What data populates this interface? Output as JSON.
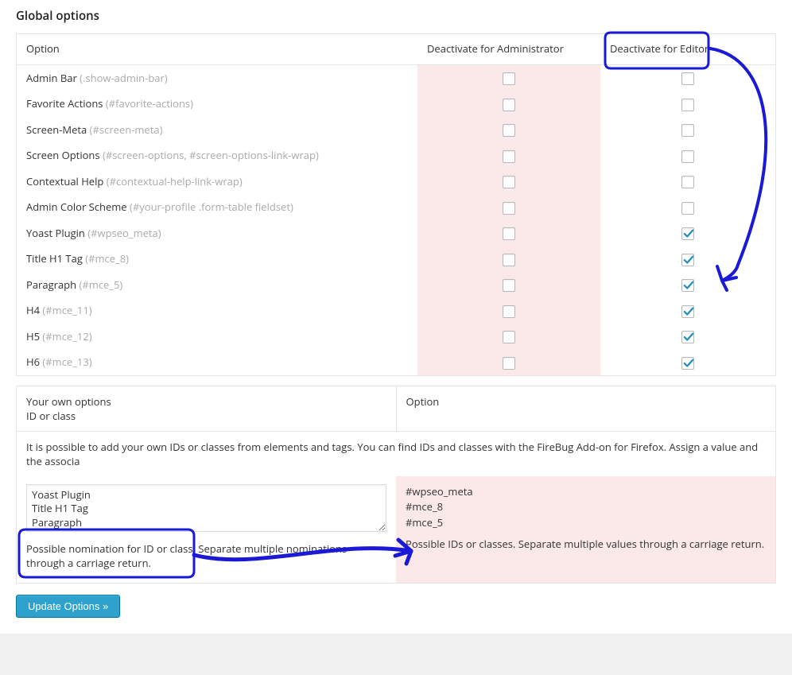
{
  "section_title": "Global options",
  "headers": {
    "option": "Option",
    "admin": "Deactivate for Administrator",
    "editor": "Deactivate for Editor"
  },
  "rows": [
    {
      "label": "Admin Bar",
      "selector": "(.show-admin-bar)",
      "admin": false,
      "editor": false
    },
    {
      "label": "Favorite Actions",
      "selector": "(#favorite-actions)",
      "admin": false,
      "editor": false
    },
    {
      "label": "Screen-Meta",
      "selector": "(#screen-meta)",
      "admin": false,
      "editor": false
    },
    {
      "label": "Screen Options",
      "selector": "(#screen-options, #screen-options-link-wrap)",
      "admin": false,
      "editor": false
    },
    {
      "label": "Contextual Help",
      "selector": "(#contextual-help-link-wrap)",
      "admin": false,
      "editor": false
    },
    {
      "label": "Admin Color Scheme",
      "selector": "(#your-profile .form-table fieldset)",
      "admin": false,
      "editor": false
    },
    {
      "label": "Yoast Plugin",
      "selector": "(#wpseo_meta)",
      "admin": false,
      "editor": true
    },
    {
      "label": "Title H1 Tag",
      "selector": "(#mce_8)",
      "admin": false,
      "editor": true
    },
    {
      "label": "Paragraph",
      "selector": "(#mce_5)",
      "admin": false,
      "editor": true
    },
    {
      "label": "H4",
      "selector": "(#mce_11)",
      "admin": false,
      "editor": true
    },
    {
      "label": "H5",
      "selector": "(#mce_12)",
      "admin": false,
      "editor": true
    },
    {
      "label": "H6",
      "selector": "(#mce_13)",
      "admin": false,
      "editor": true
    }
  ],
  "own": {
    "header_left_line1": "Your own options",
    "header_left_line2": "ID or class",
    "header_right": "Option",
    "desc": "It is possible to add your own IDs or classes from elements and tags. You can find IDs and classes with the FireBug Add-on for Firefox. Assign a value and the associa",
    "textarea_value": "Yoast Plugin\nTitle H1 Tag\nParagraph",
    "left_hint": "Possible nomination for ID or class. Separate multiple nominations through a carriage return.",
    "right_values": "#wpseo_meta\n#mce_8\n#mce_5",
    "right_hint": "Possible IDs or classes. Separate multiple values through a carriage return."
  },
  "button": "Update Options »"
}
